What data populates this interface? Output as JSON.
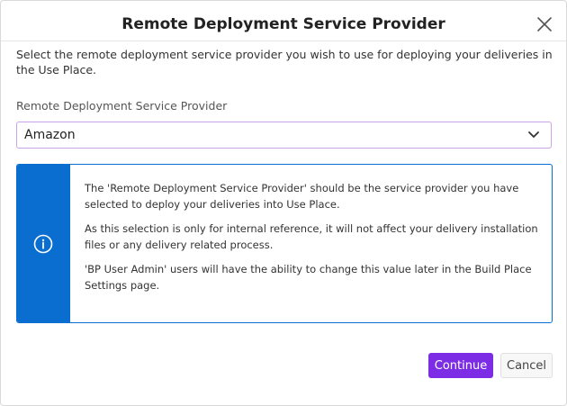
{
  "dialog": {
    "title": "Remote Deployment Service Provider",
    "description": "Select the remote deployment service provider you wish to use for deploying your deliveries in the Use Place.",
    "field_label": "Remote Deployment Service Provider",
    "select": {
      "selected_value": "Amazon"
    },
    "info": {
      "paragraphs": [
        "The 'Remote Deployment Service Provider' should be the service provider you have selected to deploy your deliveries into Use Place.",
        "As this selection is only for internal reference, it will not affect your delivery installation files or any delivery related process.",
        "'BP User Admin' users will have the ability to change this value later in the Build Place Settings page."
      ]
    },
    "buttons": {
      "continue_label": "Continue",
      "cancel_label": "Cancel"
    }
  },
  "colors": {
    "accent_purple": "#7b2ce4",
    "info_blue": "#0a6ed1",
    "select_border": "#c9a4e8"
  },
  "icons": {
    "close": "close-icon",
    "chevron": "chevron-down-icon",
    "info": "info-icon"
  }
}
